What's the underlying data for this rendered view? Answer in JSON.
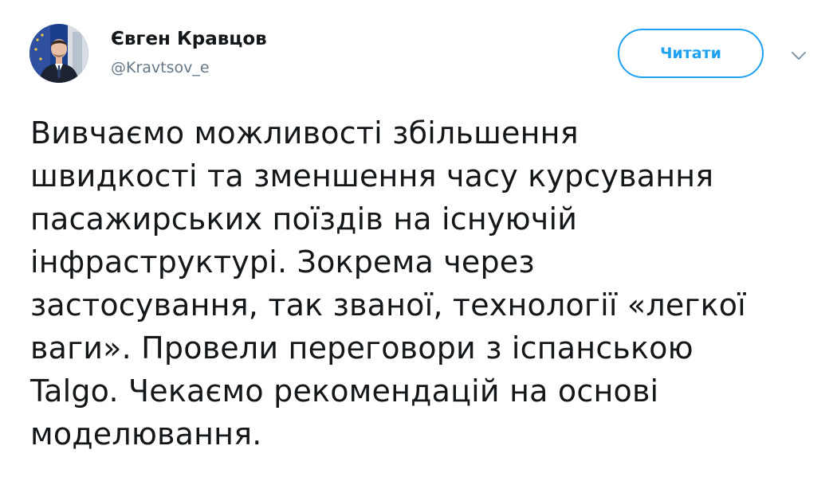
{
  "author": {
    "display_name": "Євген Кравцов",
    "handle": "@Kravtsov_e",
    "avatar_icon": "profile-photo"
  },
  "actions": {
    "follow_label": "Читати",
    "menu_icon": "chevron-down-icon"
  },
  "tweet": {
    "text": "Вивчаємо можливості збільшення\nшвидкості та зменшення часу курсування\nпасажирських поїздів на існуючій\nінфраструктурі. Зокрема через\nзастосування, так званої, технології «легкої\nваги». Провели переговори з іспанською\nTalgo. Чекаємо рекомендацій на основі\nмоделювання."
  },
  "colors": {
    "accent": "#1da1f2",
    "text": "#14171a",
    "secondary_text": "#657786"
  }
}
